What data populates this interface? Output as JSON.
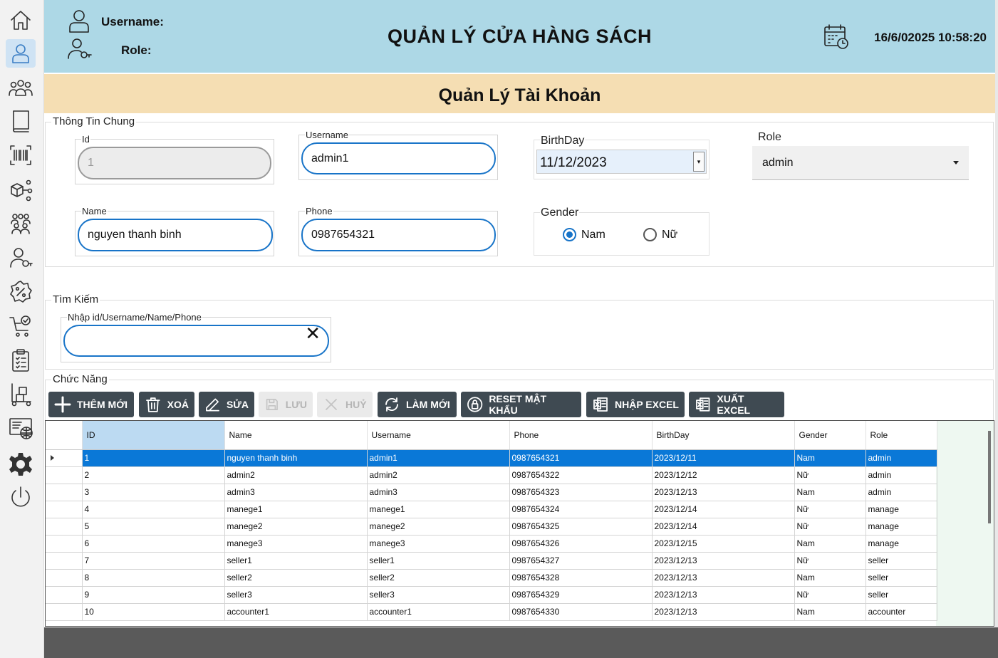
{
  "header": {
    "username_label": "Username:",
    "role_label": "Role:",
    "app_title": "QUẢN LÝ CỬA HÀNG SÁCH",
    "datetime": "16/6/02025 10:58:20"
  },
  "section": {
    "title": "Quản Lý Tài Khoản"
  },
  "general_info": {
    "legend": "Thông Tin Chung",
    "id": {
      "label": "Id",
      "value": "1"
    },
    "username": {
      "label": "Username",
      "value": "admin1"
    },
    "birthday": {
      "label": "BirthDay",
      "value": "11/12/2023"
    },
    "role": {
      "label": "Role",
      "value": "admin"
    },
    "name": {
      "label": "Name",
      "value": "nguyen thanh binh"
    },
    "phone": {
      "label": "Phone",
      "value": "0987654321"
    },
    "gender": {
      "label": "Gender",
      "options": [
        "Nam",
        "Nữ"
      ],
      "selected": "Nam"
    }
  },
  "search": {
    "legend": "Tìm Kiếm",
    "label": "Nhập id/Username/Name/Phone",
    "value": ""
  },
  "actions": {
    "legend": "Chức Năng",
    "add": "THÊM MỚI",
    "delete": "XOÁ",
    "edit": "SỬA",
    "save": "LƯU",
    "cancel": "HUỶ",
    "refresh": "LÀM MỚI",
    "reset_password": "RESET MẬT KHẨU",
    "import_excel": "NHẬP EXCEL",
    "export_excel": "XUẤT EXCEL"
  },
  "grid": {
    "columns": [
      "ID",
      "Name",
      "Username",
      "Phone",
      "BirthDay",
      "Gender",
      "Role"
    ],
    "rows": [
      [
        "1",
        "nguyen thanh binh",
        "admin1",
        "0987654321",
        "2023/12/11",
        "Nam",
        "admin"
      ],
      [
        "2",
        "admin2",
        "admin2",
        "0987654322",
        "2023/12/12",
        "Nữ",
        "admin"
      ],
      [
        "3",
        "admin3",
        "admin3",
        "0987654323",
        "2023/12/13",
        "Nam",
        "admin"
      ],
      [
        "4",
        "manege1",
        "manege1",
        "0987654324",
        "2023/12/14",
        "Nữ",
        "manage"
      ],
      [
        "5",
        "manege2",
        "manege2",
        "0987654325",
        "2023/12/14",
        "Nữ",
        "manage"
      ],
      [
        "6",
        "manege3",
        "manege3",
        "0987654326",
        "2023/12/15",
        "Nam",
        "manage"
      ],
      [
        "7",
        "seller1",
        "seller1",
        "0987654327",
        "2023/12/13",
        "Nữ",
        "seller"
      ],
      [
        "8",
        "seller2",
        "seller2",
        "0987654328",
        "2023/12/13",
        "Nam",
        "seller"
      ],
      [
        "9",
        "seller3",
        "seller3",
        "0987654329",
        "2023/12/13",
        "Nữ",
        "seller"
      ],
      [
        "10",
        "accounter1",
        "accounter1",
        "0987654330",
        "2023/12/13",
        "Nam",
        "accounter"
      ]
    ]
  },
  "sidebar": {
    "items": [
      "home-icon",
      "account-icon",
      "customers-icon",
      "book-icon",
      "barcode-icon",
      "category-icon",
      "staff-icon",
      "user-key-icon",
      "discount-icon",
      "cart-icon",
      "clipboard-icon",
      "warehouse-icon",
      "report-icon",
      "settings-icon",
      "power-icon"
    ],
    "active": "account-icon"
  },
  "colors": {
    "header_bg": "#add8e6",
    "section_bg": "#f5deb3",
    "accent": "#1874c8",
    "button_bg": "#3f4a52",
    "selected_row": "#0a78d7"
  }
}
